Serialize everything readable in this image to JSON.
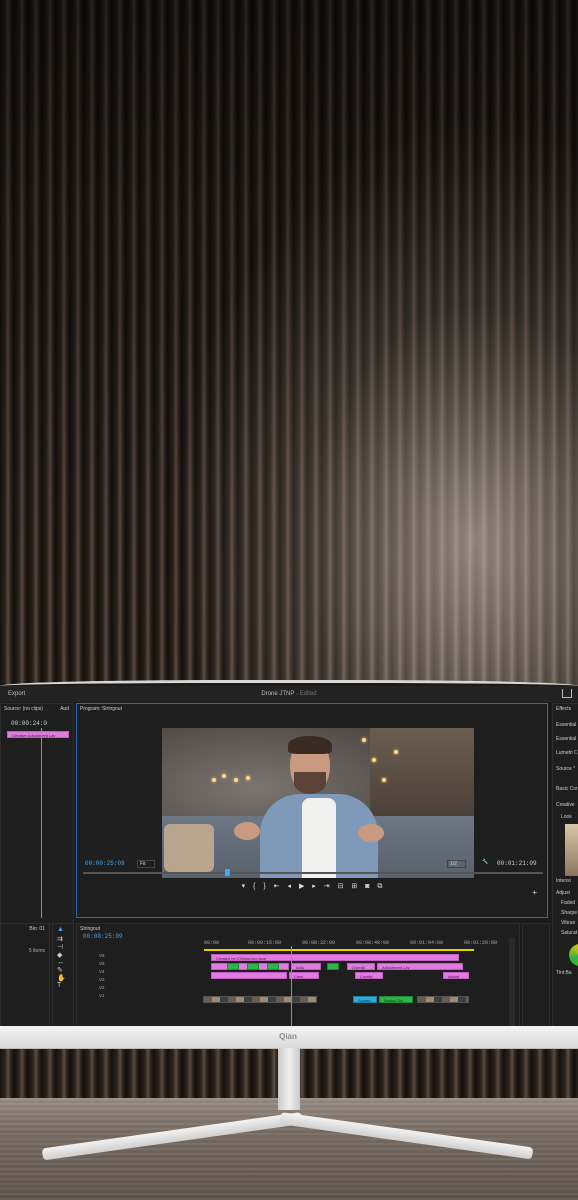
{
  "titlebar": {
    "export_label": "Export",
    "project_title": "Drone JTNP",
    "edited_label": "- Edited"
  },
  "source": {
    "title": "Source: (no clips)",
    "aud_label": "Aud",
    "timecode": "00:00:24:0",
    "clip_label": "Creative Adjustment Lay"
  },
  "program": {
    "title": "Program: Stringout",
    "current_timecode": "00:00:25:09",
    "fit_label": "Fit",
    "resolution": "1/2",
    "duration": "00:01:21:09"
  },
  "project": {
    "bin_label": "Bin: 01",
    "items_label": "5 items"
  },
  "timeline": {
    "title": "Stringout",
    "timecode": "00:00:25:09",
    "ruler": [
      "00:00",
      "00:00:16:00",
      "00:00:32:00",
      "00:00:48:00",
      "00:01:04:00",
      "00:01:20:00"
    ],
    "tracks": [
      "V6",
      "V5",
      "V4",
      "V3",
      "V2",
      "V1"
    ],
    "clip_created_by": "Created by Christopher Azar",
    "clip_adj": "Adju",
    "clip_overall": "Overall",
    "clip_adjustment": "Adjustment Lay",
    "clip_adjust2": "Adjust",
    "clip_crea": "Crea",
    "clip_creative": "Creativ",
    "clip_screen": "Screen",
    "clip_nested": "Nested Se"
  },
  "right_panel": {
    "effects": "Effects",
    "essential1": "Essential",
    "essential2": "Essential",
    "lumetri": "Lumetri C",
    "source_label": "Source *",
    "basic": "Basic Cor",
    "creative": "Creative",
    "look": "Look",
    "intensity": "Intensi",
    "adjust": "Adjust",
    "faded": "Faded",
    "sharpen": "Sharpe",
    "vibrance": "Vibran",
    "saturation": "Saturat",
    "tint": "Tint Ba"
  },
  "monitor_brand": "Qian"
}
